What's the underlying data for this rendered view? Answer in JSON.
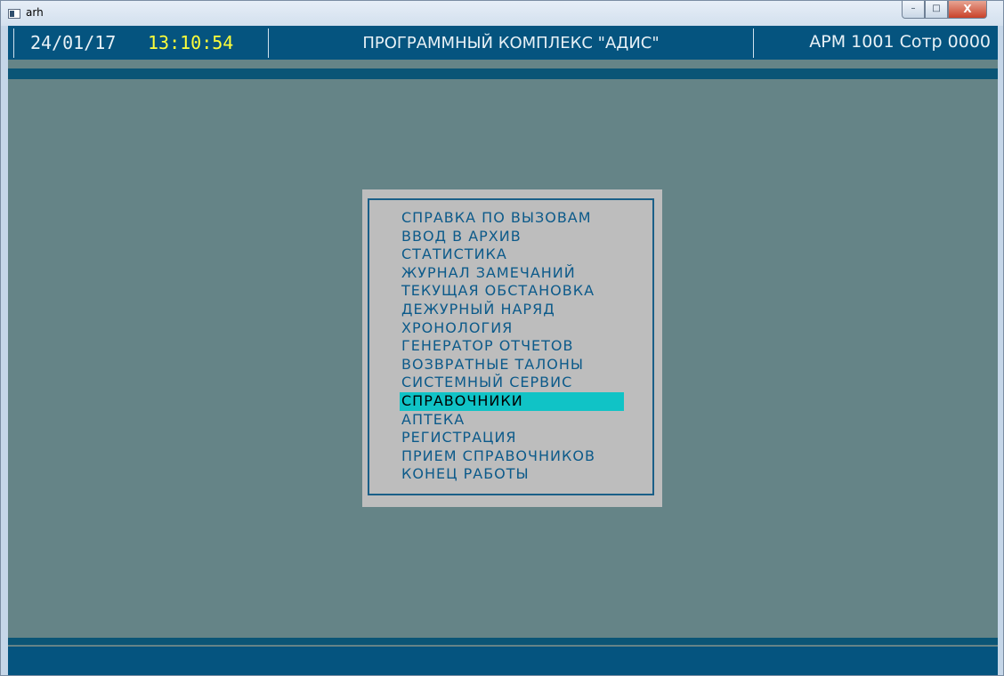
{
  "window": {
    "title": "arh",
    "controls": {
      "minimize": "–",
      "maximize": "□",
      "close": "X"
    }
  },
  "header": {
    "date": "24/01/17",
    "time": "13:10:54",
    "title": "ПРОГРАММНЫЙ КОМПЛЕКС \"АДИС\"",
    "workstation": "АРМ 1001 Сотр 0000"
  },
  "colors": {
    "background": "#658487",
    "bar": "#05547f",
    "time": "#ffff3a",
    "menu_text": "#0c5a8a",
    "menu_bg": "#bdbdbd",
    "highlight": "#10c3c6"
  },
  "menu": {
    "selected_index": 10,
    "items": [
      "СПРАВКА ПО ВЫЗОВАМ",
      "ВВОД В АРХИВ",
      "СТАТИСТИКА",
      "ЖУРНАЛ ЗАМЕЧАНИЙ",
      "ТЕКУЩАЯ ОБСТАНОВКА",
      "ДЕЖУРНЫЙ НАРЯД",
      "ХРОНОЛОГИЯ",
      "ГЕНЕРАТОР ОТЧЕТОВ",
      "ВОЗВРАТНЫЕ ТАЛОНЫ",
      "СИСТЕМНЫЙ СЕРВИС",
      "СПРАВОЧНИКИ",
      "АПТЕКА",
      "РЕГИСТРАЦИЯ",
      "ПРИЕМ СПРАВОЧНИКОВ",
      "КОНЕЦ   РАБОТЫ"
    ]
  }
}
